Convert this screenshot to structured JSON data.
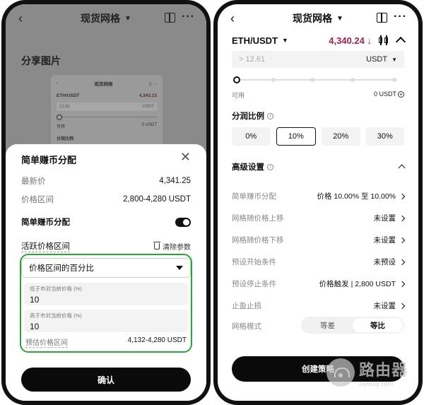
{
  "left": {
    "header": {
      "title": "现货网格"
    },
    "share_title": "分享图片",
    "thumbnail": {
      "title": "现货网格",
      "pair": "ETH/USDT",
      "price": "4,343.13",
      "input_placeholder": "12.61",
      "input_unit": "USDT",
      "available_label": "可用",
      "available_value": "0 USDT",
      "profit_ratio_label": "分润比例"
    },
    "sheet": {
      "title": "简单赚币分配",
      "latest_price_label": "最新价",
      "latest_price_value": "4,341.25",
      "price_range_label": "价格区间",
      "price_range_value": "2,800-4,280 USDT",
      "simple_earn_label": "简单赚币分配",
      "active_range_label": "活跃价格区间",
      "clear_params_label": "清除参数",
      "mode_select_value": "价格区间的百分比",
      "lower_field_label": "低于市对当前价格 (%)",
      "lower_field_value": "10",
      "upper_field_label": "高于市对当前价格 (%)",
      "upper_field_value": "10",
      "estimated_range_label": "预估价格区间",
      "estimated_range_value": "4,132-4,280 USDT",
      "confirm_label": "确认"
    }
  },
  "right": {
    "header": {
      "title": "现货网格"
    },
    "pair": "ETH/USDT",
    "price": "4,340.24",
    "price_arrow": "↓",
    "input_placeholder": "> 12.61",
    "input_unit": "USDT",
    "available_label": "可用",
    "available_value": "0 USDT",
    "profit_ratio_title": "分润比例",
    "ratio_options": [
      "0%",
      "10%",
      "20%",
      "30%"
    ],
    "ratio_selected": 1,
    "advanced_title": "高级设置",
    "settings": [
      {
        "key": "简单赚币分配",
        "value": "价格 10.00% 至 10.00%"
      },
      {
        "key": "网格随价格上移",
        "value": "未设置"
      },
      {
        "key": "网格随价格下移",
        "value": "未设置"
      },
      {
        "key": "预设开始条件",
        "value": "未预设"
      },
      {
        "key": "预设停止条件",
        "value": "价格触发 | 2,800 USDT"
      },
      {
        "key": "止盈止损",
        "value": "未设置"
      }
    ],
    "grid_mode_label": "网格模式",
    "grid_mode_options": [
      "等差",
      "等比"
    ],
    "grid_mode_selected": 1,
    "create_label": "创建策略"
  },
  "watermark": {
    "main": "路由器",
    "sub": "luyouqi.com"
  }
}
